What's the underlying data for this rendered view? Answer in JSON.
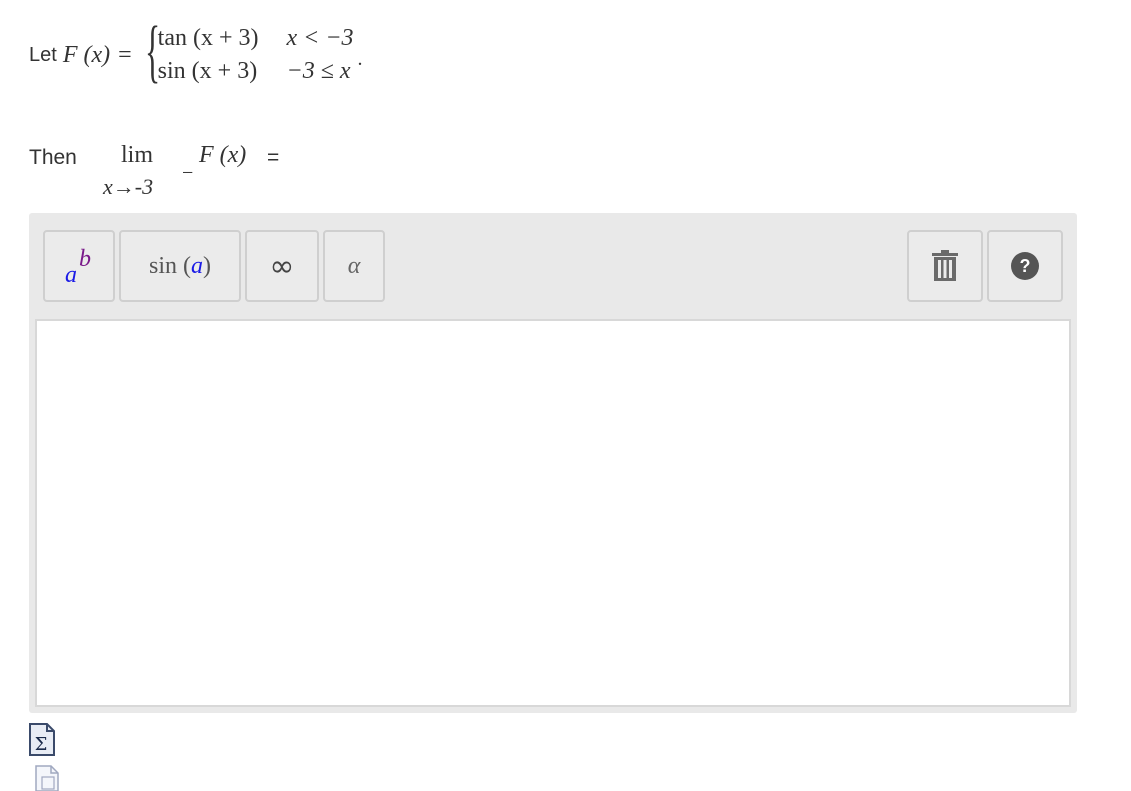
{
  "problem": {
    "let_label": "Let",
    "function_lhs": "F (x)",
    "equals": "=",
    "cases": [
      {
        "expr": "tan (x + 3)",
        "cond": "x < −3"
      },
      {
        "expr": "sin (x + 3)",
        "cond": "−3 ≤ x"
      }
    ],
    "period": "."
  },
  "question": {
    "then_label": "Then",
    "lim_word": "lim",
    "lim_sub": "x→-3",
    "lim_sup": "−",
    "func": "F (x)",
    "equals": "="
  },
  "toolbar": {
    "power_base": "a",
    "power_exp": "b",
    "sin_func": "sin",
    "sin_arg": "a",
    "infinity": "∞",
    "alpha": "α"
  },
  "icons": {
    "power": "superscript-icon",
    "sin": "function-icon",
    "infinity": "infinity-icon",
    "alpha": "greek-letter-icon",
    "clear": "trash-icon",
    "help": "help-icon",
    "sigma": "equation-editor-icon",
    "doc": "document-icon"
  },
  "colors": {
    "editor_bg": "#e9e9e9",
    "button_bg": "#ebebeb",
    "accent_blue": "#1a1ae6",
    "accent_purple": "#7a1a8a"
  }
}
